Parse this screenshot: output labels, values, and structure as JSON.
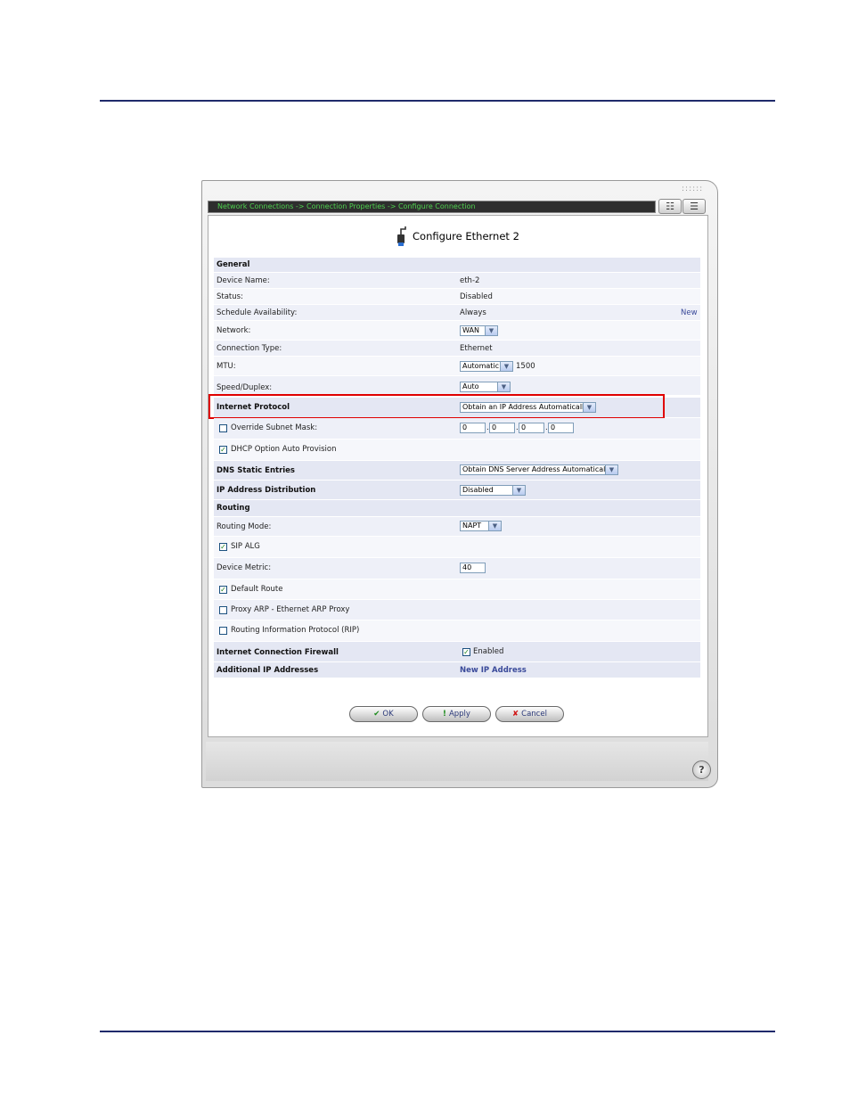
{
  "breadcrumb": "Network Connections -> Connection Properties -> Configure Connection",
  "toolbar": {
    "network_icon": "network-map-icon",
    "list_icon": "list-icon"
  },
  "title": "Configure Ethernet 2",
  "general": {
    "header": "General",
    "device_name_label": "Device Name:",
    "device_name_value": "eth-2",
    "status_label": "Status:",
    "status_value": "Disabled",
    "schedule_label": "Schedule Availability:",
    "schedule_value": "Always",
    "schedule_new": "New",
    "network_label": "Network:",
    "network_value": "WAN",
    "connection_type_label": "Connection Type:",
    "connection_type_value": "Ethernet",
    "mtu_label": "MTU:",
    "mtu_mode": "Automatic",
    "mtu_value": "1500",
    "speed_label": "Speed/Duplex:",
    "speed_value": "Auto"
  },
  "internet_protocol": {
    "label": "Internet Protocol",
    "value": "Obtain an IP Address Automatically",
    "override_mask_label": "Override Subnet Mask:",
    "override_mask_checked": false,
    "mask": [
      "0",
      "0",
      "0",
      "0"
    ],
    "dhcp_auto_label": "DHCP Option Auto Provision",
    "dhcp_auto_checked": true
  },
  "dns": {
    "label": "DNS Static Entries",
    "value": "Obtain DNS Server Address Automatically"
  },
  "ip_distribution": {
    "label": "IP Address Distribution",
    "value": "Disabled"
  },
  "routing": {
    "header": "Routing",
    "mode_label": "Routing Mode:",
    "mode_value": "NAPT",
    "sip_alg_label": "SIP ALG",
    "sip_alg_checked": true,
    "metric_label": "Device Metric:",
    "metric_value": "40",
    "default_route_label": "Default Route",
    "default_route_checked": true,
    "proxy_arp_label": "Proxy ARP - Ethernet ARP Proxy",
    "proxy_arp_checked": false,
    "rip_label": "Routing Information Protocol (RIP)",
    "rip_checked": false
  },
  "firewall": {
    "label": "Internet Connection Firewall",
    "value": "Enabled",
    "checked": true
  },
  "additional_ip": {
    "label": "Additional IP Addresses",
    "link": "New IP Address"
  },
  "buttons": {
    "ok": "OK",
    "apply": "Apply",
    "cancel": "Cancel"
  },
  "colors": {
    "highlight_border": "#e00000",
    "crumb_text": "#4fd14f",
    "rule": "#1f2a6b"
  }
}
